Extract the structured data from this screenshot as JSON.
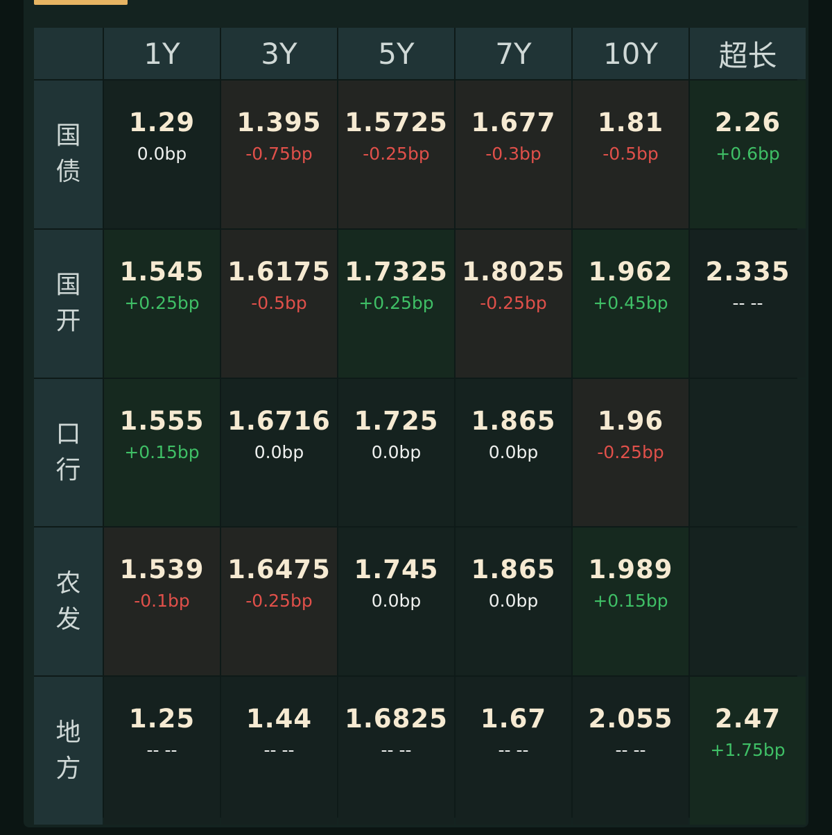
{
  "accent_color": "#e7b463",
  "colors": {
    "up": "#3fbf66",
    "down": "#e0504a",
    "flat": "#eef0ee",
    "value": "#f6ead2"
  },
  "columns": [
    "1Y",
    "3Y",
    "5Y",
    "7Y",
    "10Y",
    "超长"
  ],
  "rows": [
    {
      "label": [
        "国",
        "债"
      ],
      "cells": [
        {
          "value": "1.29",
          "change": "0.0bp",
          "trend": "flat"
        },
        {
          "value": "1.395",
          "change": "-0.75bp",
          "trend": "down"
        },
        {
          "value": "1.5725",
          "change": "-0.25bp",
          "trend": "down"
        },
        {
          "value": "1.677",
          "change": "-0.3bp",
          "trend": "down"
        },
        {
          "value": "1.81",
          "change": "-0.5bp",
          "trend": "down"
        },
        {
          "value": "2.26",
          "change": "+0.6bp",
          "trend": "up"
        }
      ]
    },
    {
      "label": [
        "国",
        "开"
      ],
      "cells": [
        {
          "value": "1.545",
          "change": "+0.25bp",
          "trend": "up"
        },
        {
          "value": "1.6175",
          "change": "-0.5bp",
          "trend": "down"
        },
        {
          "value": "1.7325",
          "change": "+0.25bp",
          "trend": "up"
        },
        {
          "value": "1.8025",
          "change": "-0.25bp",
          "trend": "down"
        },
        {
          "value": "1.962",
          "change": "+0.45bp",
          "trend": "up"
        },
        {
          "value": "2.335",
          "change": "-- --",
          "trend": "none"
        }
      ]
    },
    {
      "label": [
        "口",
        "行"
      ],
      "cells": [
        {
          "value": "1.555",
          "change": "+0.15bp",
          "trend": "up"
        },
        {
          "value": "1.6716",
          "change": "0.0bp",
          "trend": "flat"
        },
        {
          "value": "1.725",
          "change": "0.0bp",
          "trend": "flat"
        },
        {
          "value": "1.865",
          "change": "0.0bp",
          "trend": "flat"
        },
        {
          "value": "1.96",
          "change": "-0.25bp",
          "trend": "down"
        },
        {
          "value": "",
          "change": "",
          "trend": "empty"
        }
      ]
    },
    {
      "label": [
        "农",
        "发"
      ],
      "cells": [
        {
          "value": "1.539",
          "change": "-0.1bp",
          "trend": "down"
        },
        {
          "value": "1.6475",
          "change": "-0.25bp",
          "trend": "down"
        },
        {
          "value": "1.745",
          "change": "0.0bp",
          "trend": "flat"
        },
        {
          "value": "1.865",
          "change": "0.0bp",
          "trend": "flat"
        },
        {
          "value": "1.989",
          "change": "+0.15bp",
          "trend": "up"
        },
        {
          "value": "",
          "change": "",
          "trend": "empty"
        }
      ]
    },
    {
      "label": [
        "地",
        "方"
      ],
      "cells": [
        {
          "value": "1.25",
          "change": "-- --",
          "trend": "none"
        },
        {
          "value": "1.44",
          "change": "-- --",
          "trend": "none"
        },
        {
          "value": "1.6825",
          "change": "-- --",
          "trend": "none"
        },
        {
          "value": "1.67",
          "change": "-- --",
          "trend": "none"
        },
        {
          "value": "2.055",
          "change": "-- --",
          "trend": "none"
        },
        {
          "value": "2.47",
          "change": "+1.75bp",
          "trend": "up"
        }
      ]
    }
  ]
}
